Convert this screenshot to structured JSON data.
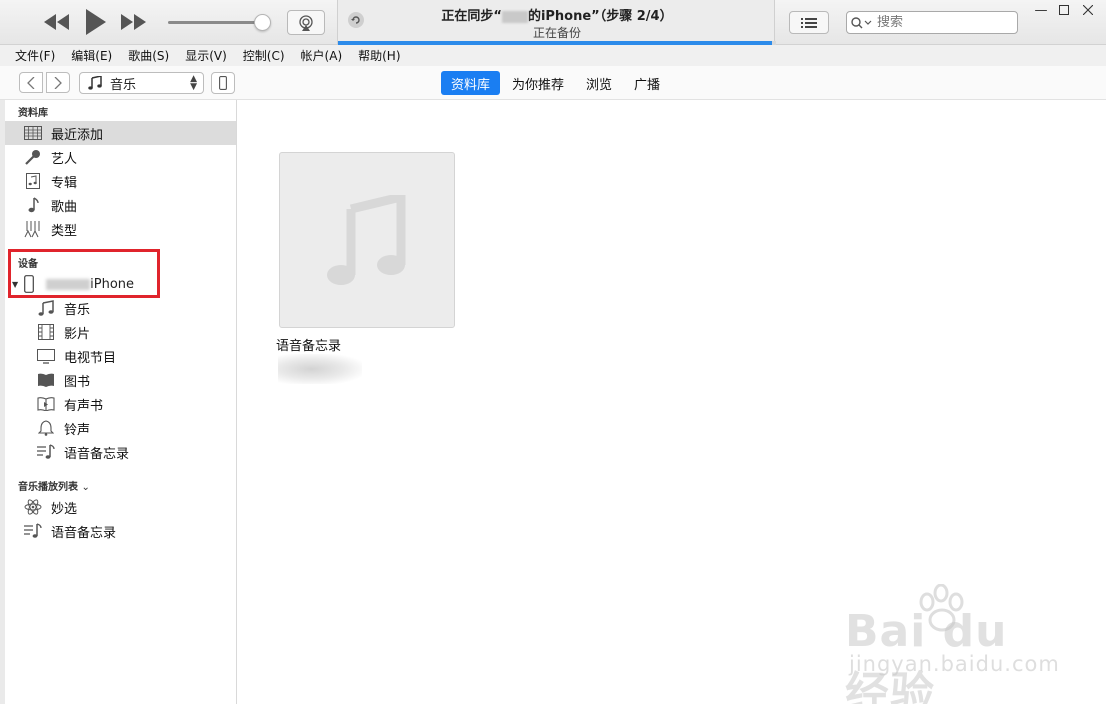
{
  "player": {
    "status_title_prefix": "正在同步“",
    "status_title_suffix": "的iPhone”（步骤 2/4）",
    "status_subtitle": "正在备份",
    "sync_progress": 0.99,
    "volume_level": 0.9
  },
  "search": {
    "placeholder": "搜索"
  },
  "menubar": {
    "items": [
      "文件(F)",
      "编辑(E)",
      "歌曲(S)",
      "显示(V)",
      "控制(C)",
      "帐户(A)",
      "帮助(H)"
    ]
  },
  "nav": {
    "media_kind": "音乐",
    "tabs": [
      "资料库",
      "为你推荐",
      "浏览",
      "广播"
    ],
    "active_tab": "资料库"
  },
  "sidebar": {
    "library_header": "资料库",
    "library_items": [
      {
        "label": "最近添加",
        "icon": "grid-icon"
      },
      {
        "label": "艺人",
        "icon": "microphone-icon"
      },
      {
        "label": "专辑",
        "icon": "album-icon"
      },
      {
        "label": "歌曲",
        "icon": "music-note-icon"
      },
      {
        "label": "类型",
        "icon": "genre-icon"
      }
    ],
    "devices_header": "设备",
    "device_name_suffix": "iPhone",
    "device_items": [
      {
        "label": "音乐",
        "icon": "music-note-icon"
      },
      {
        "label": "影片",
        "icon": "film-icon"
      },
      {
        "label": "电视节目",
        "icon": "tv-icon"
      },
      {
        "label": "图书",
        "icon": "book-icon"
      },
      {
        "label": "有声书",
        "icon": "audiobook-icon"
      },
      {
        "label": "铃声",
        "icon": "bell-icon"
      },
      {
        "label": "语音备忘录",
        "icon": "voice-memo-icon"
      }
    ],
    "playlists_header": "音乐播放列表",
    "playlist_items": [
      {
        "label": "妙选",
        "icon": "atom-icon"
      },
      {
        "label": "语音备忘录",
        "icon": "voice-memo-icon"
      }
    ]
  },
  "main": {
    "album_title": "语音备忘录"
  },
  "watermark": {
    "brand": "Bai du 经验",
    "url": "jingyan.baidu.com"
  },
  "colors": {
    "accent": "#1a7ef2",
    "highlight_box": "#e0242c"
  }
}
